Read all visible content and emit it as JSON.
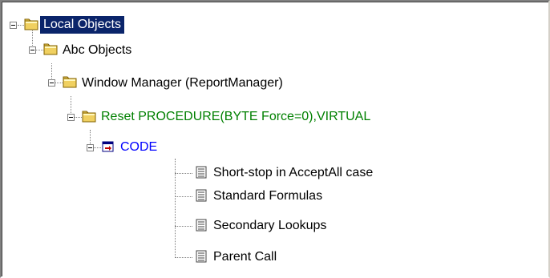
{
  "tree": {
    "nodes": [
      {
        "label": "Local Objects",
        "icon": "folder-icon",
        "color": "#000000",
        "selected": true,
        "expanded": true
      },
      {
        "label": "Abc Objects",
        "icon": "folder-icon",
        "color": "#000000",
        "selected": false,
        "expanded": true
      },
      {
        "label": "Window Manager (ReportManager)",
        "icon": "folder-icon",
        "color": "#000000",
        "selected": false,
        "expanded": true
      },
      {
        "label": "Reset PROCEDURE(BYTE Force=0),VIRTUAL",
        "icon": "folder-icon",
        "color": "#008000",
        "selected": false,
        "expanded": true
      },
      {
        "label": "CODE",
        "icon": "code-embed-icon",
        "color": "#0000ff",
        "selected": false,
        "expanded": true
      },
      {
        "label": "Short-stop in AcceptAll case",
        "icon": "document-icon",
        "color": "#000000",
        "selected": false
      },
      {
        "label": "Standard Formulas",
        "icon": "document-icon",
        "color": "#000000",
        "selected": false
      },
      {
        "label": "Secondary Lookups",
        "icon": "document-icon",
        "color": "#000000",
        "selected": false
      },
      {
        "label": "Parent Call",
        "icon": "document-icon",
        "color": "#000000",
        "selected": false
      }
    ]
  },
  "colors": {
    "selection": "#0a246a",
    "procedure": "#008000",
    "code": "#0000ff",
    "folder": "#f0d060"
  }
}
